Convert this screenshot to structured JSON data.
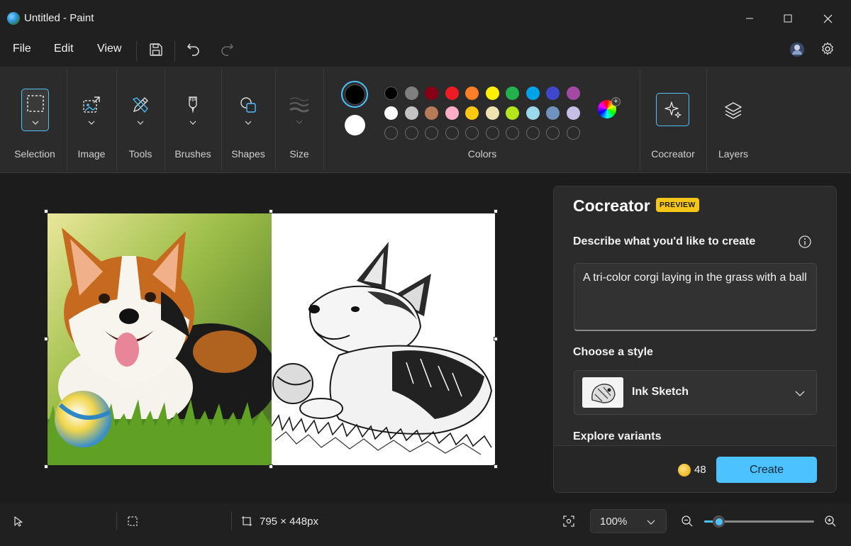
{
  "window": {
    "title": "Untitled - Paint"
  },
  "menu": {
    "file": "File",
    "edit": "Edit",
    "view": "View"
  },
  "ribbon": {
    "groups": {
      "selection": "Selection",
      "image": "Image",
      "tools": "Tools",
      "brushes": "Brushes",
      "shapes": "Shapes",
      "size": "Size",
      "colors": "Colors",
      "cocreator": "Cocreator",
      "layers": "Layers"
    },
    "primary_color": "#000000",
    "secondary_color": "#ffffff",
    "palette_row1": [
      "#000000",
      "#7f7f7f",
      "#880015",
      "#ed1c24",
      "#ff7f27",
      "#fff200",
      "#22b14c",
      "#00a2e8",
      "#3f48cc",
      "#a349a4"
    ],
    "palette_row2": [
      "#ffffff",
      "#c3c3c3",
      "#b97a57",
      "#ffaec9",
      "#ffc90e",
      "#efe4b0",
      "#b5e61d",
      "#99d9ea",
      "#7092be",
      "#c8bfe7"
    ]
  },
  "cocreator": {
    "title": "Cocreator",
    "badge": "PREVIEW",
    "describe_label": "Describe what you'd like to create",
    "prompt": "A tri-color corgi laying in the grass with a ball",
    "style_label": "Choose a style",
    "style_value": "Ink Sketch",
    "explore_label": "Explore variants",
    "credits": "48",
    "create_label": "Create"
  },
  "status": {
    "canvas_size": "795 × 448px",
    "zoom": "100%",
    "zoom_slider_fraction": 0.13
  },
  "colors": {
    "accent": "#4cc2ff",
    "badge": "#f5c518"
  }
}
